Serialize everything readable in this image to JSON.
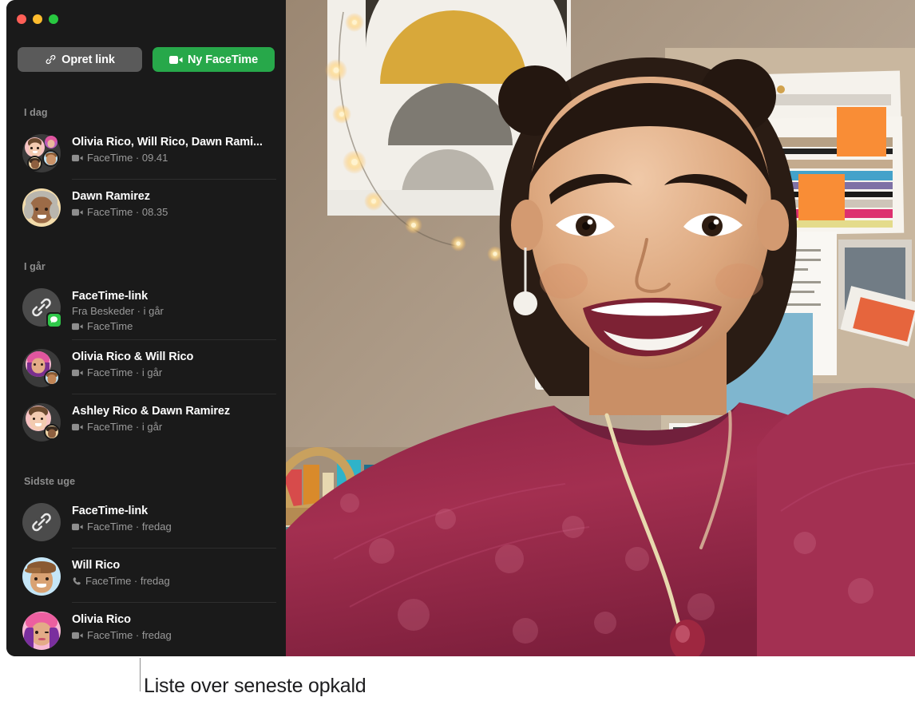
{
  "window": {
    "traffic_lights": [
      {
        "name": "close",
        "color": "#ff5f57"
      },
      {
        "name": "minimize",
        "color": "#febc2e"
      },
      {
        "name": "zoom",
        "color": "#28c840"
      }
    ]
  },
  "toolbar": {
    "create_link_label": "Opret link",
    "create_link_icon": "link-icon",
    "new_facetime_label": "Ny FaceTime",
    "new_facetime_icon": "video-camera-icon",
    "new_facetime_color": "#27a84a",
    "create_link_color": "#5a5a5a"
  },
  "sidebar": {
    "sections": [
      {
        "header": "I dag",
        "items": [
          {
            "title": "Olivia Rico, Will Rico, Dawn Rami...",
            "subtitle": "FaceTime · 09.41",
            "icon": "video-camera-icon",
            "avatar": "group-memoji"
          },
          {
            "title": "Dawn Ramirez",
            "subtitle": "FaceTime · 08.35",
            "icon": "video-camera-icon",
            "avatar": "memoji-dawn"
          }
        ]
      },
      {
        "header": "I går",
        "items": [
          {
            "title": "FaceTime-link",
            "source": "Fra Beskeder · i går",
            "subtitle": "FaceTime",
            "icon": "video-camera-icon",
            "avatar": "link-icon",
            "badge": "messages-icon"
          },
          {
            "title": "Olivia Rico & Will Rico",
            "subtitle": "FaceTime · i går",
            "icon": "video-camera-icon",
            "avatar": "pair-olivia-will"
          },
          {
            "title": "Ashley Rico & Dawn Ramirez",
            "subtitle": "FaceTime · i går",
            "icon": "video-camera-icon",
            "avatar": "pair-ashley-dawn"
          }
        ]
      },
      {
        "header": "Sidste uge",
        "items": [
          {
            "title": "FaceTime-link",
            "subtitle": "FaceTime · fredag",
            "icon": "video-camera-icon",
            "avatar": "link-icon"
          },
          {
            "title": "Will Rico",
            "subtitle": "FaceTime · fredag",
            "icon": "phone-icon",
            "avatar": "memoji-will"
          },
          {
            "title": "Olivia Rico",
            "subtitle": "FaceTime · fredag",
            "icon": "video-camera-icon",
            "avatar": "memoji-olivia"
          }
        ]
      }
    ]
  },
  "video": {
    "description": "FaceTime video of a smiling person in a maroon fuzzy sweater in a room with wall art, string lights, a pinboard and polaroid photos"
  },
  "callout": {
    "text": "Liste over seneste opkald"
  }
}
